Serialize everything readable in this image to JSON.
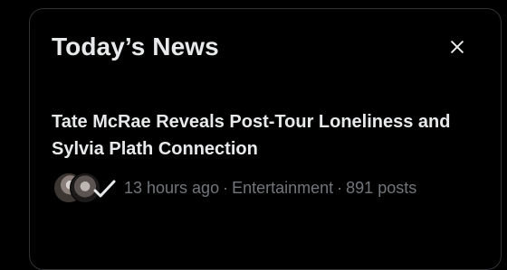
{
  "panel": {
    "title": "Today’s News",
    "close_icon": "close-icon"
  },
  "story": {
    "headline": "Tate McRae Reveals Post-Tour Loneliness and Sylvia Plath Connection",
    "time": "13 hours ago",
    "category": "Entertainment",
    "posts": "891 posts",
    "separator": "·"
  },
  "colors": {
    "background": "#000000",
    "border": "#2f3336",
    "primary_text": "#e7e9ea",
    "secondary_text": "#71767b"
  }
}
